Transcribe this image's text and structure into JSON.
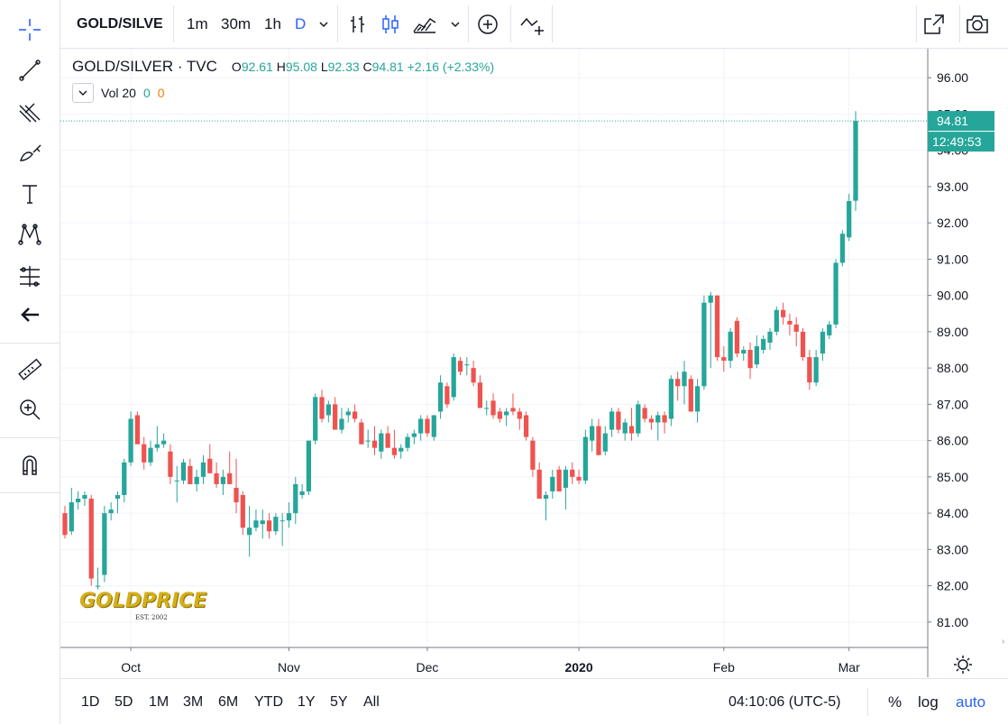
{
  "toolbar": {
    "symbol": "GOLD/SILVE",
    "intervals": [
      "1m",
      "30m",
      "1h",
      "D"
    ],
    "active_interval": "D"
  },
  "legend": {
    "title": "GOLD/SILVER · TVC",
    "open_label": "O",
    "open": "92.61",
    "high_label": "H",
    "high": "95.08",
    "low_label": "L",
    "low": "92.33",
    "close_label": "C",
    "close": "94.81",
    "change": "+2.16 (+2.33%)",
    "volume_label": "Vol 20",
    "volume_value_1": "0",
    "volume_value_2": "0"
  },
  "price_axis": {
    "last_price": "94.81",
    "countdown": "12:49:53",
    "ticks": [
      "96.00",
      "95.00",
      "94.00",
      "93.00",
      "92.00",
      "91.00",
      "90.00",
      "89.00",
      "88.00",
      "87.00",
      "86.00",
      "85.00",
      "84.00",
      "83.00",
      "82.00",
      "81.00"
    ]
  },
  "time_axis": {
    "labels": [
      {
        "text": "Oct",
        "bold": false
      },
      {
        "text": "Nov",
        "bold": false
      },
      {
        "text": "Dec",
        "bold": false
      },
      {
        "text": "2020",
        "bold": true
      },
      {
        "text": "Feb",
        "bold": false
      },
      {
        "text": "Mar",
        "bold": false
      }
    ]
  },
  "bottom": {
    "ranges": [
      "1D",
      "5D",
      "1M",
      "3M",
      "6M",
      "YTD",
      "1Y",
      "5Y",
      "All"
    ],
    "clock": "04:10:06 (UTC-5)",
    "percent": "%",
    "log": "log",
    "auto": "auto"
  },
  "logo": {
    "word": "GOLDPRICE",
    "est": "EST. 2002"
  },
  "colors": {
    "up": "#26a69a",
    "down": "#ef5350",
    "accent": "#2962ff"
  },
  "chart_data": {
    "type": "candlestick",
    "title": "GOLD/SILVER · TVC",
    "ylim": [
      80.3,
      96.8
    ],
    "x_tick_labels": [
      "Oct",
      "Nov",
      "Dec",
      "2020",
      "Feb",
      "Mar"
    ],
    "y_tick_labels": [
      "81.00",
      "82.00",
      "83.00",
      "84.00",
      "85.00",
      "86.00",
      "87.00",
      "88.00",
      "89.00",
      "90.00",
      "91.00",
      "92.00",
      "93.00",
      "94.00",
      "95.00",
      "96.00"
    ],
    "candles": [
      {
        "o": 84.0,
        "h": 84.2,
        "l": 83.3,
        "c": 83.4
      },
      {
        "o": 83.5,
        "h": 84.7,
        "l": 83.4,
        "c": 84.3
      },
      {
        "o": 84.3,
        "h": 84.6,
        "l": 84.1,
        "c": 84.4
      },
      {
        "o": 84.4,
        "h": 84.6,
        "l": 84.2,
        "c": 84.5
      },
      {
        "o": 84.4,
        "h": 84.5,
        "l": 82.0,
        "c": 82.2
      },
      {
        "o": 82.0,
        "h": 82.5,
        "l": 81.9,
        "c": 82.0
      },
      {
        "o": 82.3,
        "h": 84.2,
        "l": 82.1,
        "c": 84.0
      },
      {
        "o": 84.0,
        "h": 84.3,
        "l": 83.8,
        "c": 84.1
      },
      {
        "o": 84.4,
        "h": 84.6,
        "l": 84.0,
        "c": 84.5
      },
      {
        "o": 84.5,
        "h": 85.5,
        "l": 84.3,
        "c": 85.4
      },
      {
        "o": 85.4,
        "h": 86.8,
        "l": 85.3,
        "c": 86.6
      },
      {
        "o": 86.7,
        "h": 86.8,
        "l": 85.9,
        "c": 85.9
      },
      {
        "o": 85.9,
        "h": 86.1,
        "l": 85.2,
        "c": 85.4
      },
      {
        "o": 85.4,
        "h": 86.0,
        "l": 85.3,
        "c": 85.8
      },
      {
        "o": 85.8,
        "h": 86.4,
        "l": 85.7,
        "c": 85.9
      },
      {
        "o": 85.9,
        "h": 86.2,
        "l": 85.8,
        "c": 86.0
      },
      {
        "o": 85.7,
        "h": 85.9,
        "l": 84.8,
        "c": 85.0
      },
      {
        "o": 84.9,
        "h": 85.3,
        "l": 84.3,
        "c": 84.9
      },
      {
        "o": 84.9,
        "h": 85.5,
        "l": 84.8,
        "c": 85.4
      },
      {
        "o": 85.3,
        "h": 85.5,
        "l": 84.8,
        "c": 84.8
      },
      {
        "o": 84.8,
        "h": 85.2,
        "l": 84.6,
        "c": 85.0
      },
      {
        "o": 85.0,
        "h": 85.6,
        "l": 84.8,
        "c": 85.4
      },
      {
        "o": 85.5,
        "h": 85.9,
        "l": 85.1,
        "c": 85.1
      },
      {
        "o": 85.1,
        "h": 85.4,
        "l": 84.7,
        "c": 84.8
      },
      {
        "o": 84.8,
        "h": 85.2,
        "l": 84.5,
        "c": 85.0
      },
      {
        "o": 85.1,
        "h": 85.7,
        "l": 84.8,
        "c": 84.8
      },
      {
        "o": 84.7,
        "h": 85.5,
        "l": 84.0,
        "c": 84.3
      },
      {
        "o": 84.5,
        "h": 84.6,
        "l": 83.4,
        "c": 83.6
      },
      {
        "o": 83.4,
        "h": 84.2,
        "l": 82.8,
        "c": 83.6
      },
      {
        "o": 83.6,
        "h": 84.1,
        "l": 83.5,
        "c": 83.8
      },
      {
        "o": 83.7,
        "h": 84.1,
        "l": 83.3,
        "c": 83.8
      },
      {
        "o": 83.8,
        "h": 84.0,
        "l": 83.3,
        "c": 83.5
      },
      {
        "o": 83.5,
        "h": 84.0,
        "l": 83.4,
        "c": 83.9
      },
      {
        "o": 83.8,
        "h": 84.0,
        "l": 83.1,
        "c": 83.8
      },
      {
        "o": 83.8,
        "h": 84.3,
        "l": 83.6,
        "c": 84.0
      },
      {
        "o": 84.0,
        "h": 85.0,
        "l": 83.7,
        "c": 84.8
      },
      {
        "o": 84.5,
        "h": 84.8,
        "l": 84.4,
        "c": 84.6
      },
      {
        "o": 84.6,
        "h": 86.0,
        "l": 84.5,
        "c": 86.0
      },
      {
        "o": 86.0,
        "h": 87.3,
        "l": 85.9,
        "c": 87.2
      },
      {
        "o": 87.2,
        "h": 87.4,
        "l": 86.5,
        "c": 86.6
      },
      {
        "o": 86.7,
        "h": 87.1,
        "l": 86.5,
        "c": 87.0
      },
      {
        "o": 87.0,
        "h": 87.2,
        "l": 86.3,
        "c": 86.3
      },
      {
        "o": 86.3,
        "h": 86.9,
        "l": 86.2,
        "c": 86.6
      },
      {
        "o": 86.7,
        "h": 86.9,
        "l": 86.5,
        "c": 86.8
      },
      {
        "o": 86.8,
        "h": 87.0,
        "l": 86.5,
        "c": 86.6
      },
      {
        "o": 86.5,
        "h": 86.6,
        "l": 85.9,
        "c": 85.9
      },
      {
        "o": 86.0,
        "h": 86.3,
        "l": 85.8,
        "c": 86.0
      },
      {
        "o": 86.0,
        "h": 86.4,
        "l": 85.6,
        "c": 85.8
      },
      {
        "o": 85.7,
        "h": 86.3,
        "l": 85.5,
        "c": 86.2
      },
      {
        "o": 86.2,
        "h": 86.4,
        "l": 85.8,
        "c": 85.8
      },
      {
        "o": 85.8,
        "h": 86.3,
        "l": 85.5,
        "c": 85.6
      },
      {
        "o": 85.7,
        "h": 85.9,
        "l": 85.5,
        "c": 85.8
      },
      {
        "o": 85.8,
        "h": 86.2,
        "l": 85.7,
        "c": 86.1
      },
      {
        "o": 86.1,
        "h": 86.3,
        "l": 85.9,
        "c": 86.2
      },
      {
        "o": 86.2,
        "h": 86.7,
        "l": 86.0,
        "c": 86.6
      },
      {
        "o": 86.6,
        "h": 86.7,
        "l": 86.1,
        "c": 86.2
      },
      {
        "o": 86.1,
        "h": 86.7,
        "l": 86.0,
        "c": 86.7
      },
      {
        "o": 86.8,
        "h": 87.8,
        "l": 86.6,
        "c": 87.6
      },
      {
        "o": 87.5,
        "h": 87.6,
        "l": 86.9,
        "c": 87.0
      },
      {
        "o": 87.2,
        "h": 88.4,
        "l": 87.1,
        "c": 88.3
      },
      {
        "o": 88.2,
        "h": 88.3,
        "l": 87.8,
        "c": 87.9
      },
      {
        "o": 88.1,
        "h": 88.3,
        "l": 87.8,
        "c": 88.1
      },
      {
        "o": 88.0,
        "h": 88.2,
        "l": 87.5,
        "c": 87.6
      },
      {
        "o": 87.6,
        "h": 87.8,
        "l": 86.9,
        "c": 86.9
      },
      {
        "o": 86.9,
        "h": 87.1,
        "l": 86.7,
        "c": 86.9
      },
      {
        "o": 87.1,
        "h": 87.3,
        "l": 86.6,
        "c": 86.7
      },
      {
        "o": 86.8,
        "h": 86.9,
        "l": 86.5,
        "c": 86.6
      },
      {
        "o": 86.7,
        "h": 86.9,
        "l": 86.4,
        "c": 86.8
      },
      {
        "o": 86.9,
        "h": 87.3,
        "l": 86.7,
        "c": 86.8
      },
      {
        "o": 86.8,
        "h": 86.9,
        "l": 86.3,
        "c": 86.6
      },
      {
        "o": 86.7,
        "h": 86.8,
        "l": 86.0,
        "c": 86.1
      },
      {
        "o": 86.0,
        "h": 86.1,
        "l": 85.0,
        "c": 85.2
      },
      {
        "o": 85.2,
        "h": 85.4,
        "l": 84.4,
        "c": 84.4
      },
      {
        "o": 84.4,
        "h": 84.6,
        "l": 83.8,
        "c": 84.5
      },
      {
        "o": 84.6,
        "h": 85.2,
        "l": 84.4,
        "c": 85.0
      },
      {
        "o": 85.2,
        "h": 85.3,
        "l": 84.6,
        "c": 84.6
      },
      {
        "o": 84.7,
        "h": 85.3,
        "l": 84.1,
        "c": 85.2
      },
      {
        "o": 85.2,
        "h": 85.4,
        "l": 84.8,
        "c": 85.0
      },
      {
        "o": 85.0,
        "h": 85.2,
        "l": 84.8,
        "c": 84.9
      },
      {
        "o": 84.9,
        "h": 86.3,
        "l": 84.8,
        "c": 86.1
      },
      {
        "o": 86.0,
        "h": 86.6,
        "l": 85.7,
        "c": 86.4
      },
      {
        "o": 86.4,
        "h": 86.6,
        "l": 85.6,
        "c": 85.6
      },
      {
        "o": 85.7,
        "h": 86.4,
        "l": 85.6,
        "c": 86.2
      },
      {
        "o": 86.3,
        "h": 86.9,
        "l": 86.1,
        "c": 86.8
      },
      {
        "o": 86.8,
        "h": 86.9,
        "l": 86.2,
        "c": 86.3
      },
      {
        "o": 86.2,
        "h": 86.6,
        "l": 86.0,
        "c": 86.5
      },
      {
        "o": 86.4,
        "h": 86.9,
        "l": 86.0,
        "c": 86.2
      },
      {
        "o": 86.2,
        "h": 87.1,
        "l": 86.1,
        "c": 87.0
      },
      {
        "o": 86.9,
        "h": 87.0,
        "l": 86.5,
        "c": 86.6
      },
      {
        "o": 86.6,
        "h": 86.7,
        "l": 86.3,
        "c": 86.5
      },
      {
        "o": 86.5,
        "h": 86.8,
        "l": 86.0,
        "c": 86.7
      },
      {
        "o": 86.7,
        "h": 86.8,
        "l": 86.2,
        "c": 86.5
      },
      {
        "o": 86.6,
        "h": 87.8,
        "l": 86.4,
        "c": 87.7
      },
      {
        "o": 87.7,
        "h": 87.9,
        "l": 87.1,
        "c": 87.5
      },
      {
        "o": 87.5,
        "h": 88.2,
        "l": 87.0,
        "c": 87.9
      },
      {
        "o": 87.7,
        "h": 87.8,
        "l": 86.8,
        "c": 86.8
      },
      {
        "o": 86.8,
        "h": 87.7,
        "l": 86.5,
        "c": 87.5
      },
      {
        "o": 87.5,
        "h": 90.0,
        "l": 87.4,
        "c": 89.8
      },
      {
        "o": 89.8,
        "h": 90.1,
        "l": 88.0,
        "c": 90.0
      },
      {
        "o": 90.0,
        "h": 90.0,
        "l": 88.2,
        "c": 88.3
      },
      {
        "o": 88.3,
        "h": 88.6,
        "l": 87.9,
        "c": 88.2
      },
      {
        "o": 88.2,
        "h": 89.1,
        "l": 88.0,
        "c": 89.0
      },
      {
        "o": 89.3,
        "h": 89.4,
        "l": 88.3,
        "c": 88.4
      },
      {
        "o": 88.4,
        "h": 88.6,
        "l": 88.2,
        "c": 88.5
      },
      {
        "o": 88.5,
        "h": 88.7,
        "l": 87.7,
        "c": 88.0
      },
      {
        "o": 88.1,
        "h": 88.9,
        "l": 88.0,
        "c": 88.6
      },
      {
        "o": 88.5,
        "h": 88.9,
        "l": 88.4,
        "c": 88.8
      },
      {
        "o": 88.7,
        "h": 89.1,
        "l": 88.5,
        "c": 89.0
      },
      {
        "o": 89.0,
        "h": 89.7,
        "l": 88.9,
        "c": 89.6
      },
      {
        "o": 89.6,
        "h": 89.8,
        "l": 89.2,
        "c": 89.4
      },
      {
        "o": 89.3,
        "h": 89.5,
        "l": 88.9,
        "c": 89.2
      },
      {
        "o": 89.2,
        "h": 89.4,
        "l": 88.6,
        "c": 89.0
      },
      {
        "o": 89.0,
        "h": 89.1,
        "l": 88.2,
        "c": 88.3
      },
      {
        "o": 88.3,
        "h": 88.5,
        "l": 87.4,
        "c": 87.6
      },
      {
        "o": 87.6,
        "h": 88.5,
        "l": 87.5,
        "c": 88.3
      },
      {
        "o": 88.4,
        "h": 89.1,
        "l": 88.2,
        "c": 89.0
      },
      {
        "o": 88.9,
        "h": 89.3,
        "l": 88.8,
        "c": 89.2
      },
      {
        "o": 89.2,
        "h": 91.0,
        "l": 89.1,
        "c": 90.9
      },
      {
        "o": 90.9,
        "h": 91.8,
        "l": 90.8,
        "c": 91.7
      },
      {
        "o": 91.6,
        "h": 92.8,
        "l": 91.5,
        "c": 92.6
      },
      {
        "o": 92.61,
        "h": 95.08,
        "l": 92.33,
        "c": 94.81
      }
    ]
  }
}
